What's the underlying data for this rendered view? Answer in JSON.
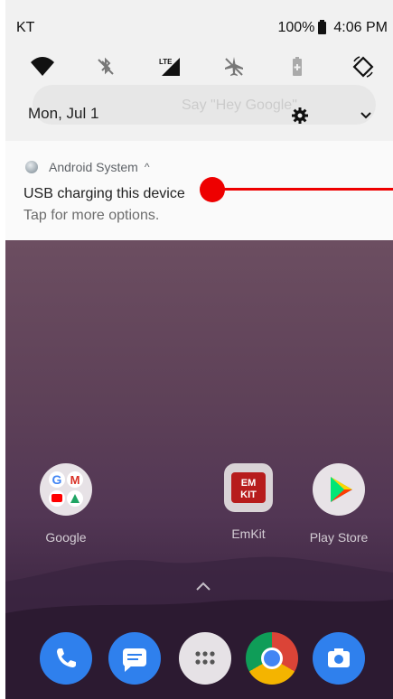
{
  "status_bar": {
    "carrier": "KT",
    "battery": "100%",
    "time": "4:06 PM"
  },
  "quick_settings": {
    "tiles": [
      "wifi-icon",
      "bluetooth-off-icon",
      "lte-signal-icon",
      "airplane-mode-icon",
      "battery-saver-icon",
      "auto-rotate-icon"
    ],
    "lte_label": "LTE"
  },
  "date_row": {
    "date": "Mon, Jul 1"
  },
  "background_search": {
    "hint": "Say \"Hey Google\""
  },
  "notification": {
    "app": "Android System",
    "expand": "^",
    "title": "USB charging this device",
    "text": "Tap for more options."
  },
  "home": {
    "apps": [
      {
        "label": "Google"
      },
      {
        "label": "EmKit"
      },
      {
        "label": "Play Store"
      }
    ],
    "dock": [
      "phone-icon",
      "messages-icon",
      "app-drawer-icon",
      "chrome-icon",
      "camera-icon"
    ]
  },
  "colors": {
    "touch_indicator": "#ee0000",
    "shade_bg": "#f1f1f1"
  }
}
